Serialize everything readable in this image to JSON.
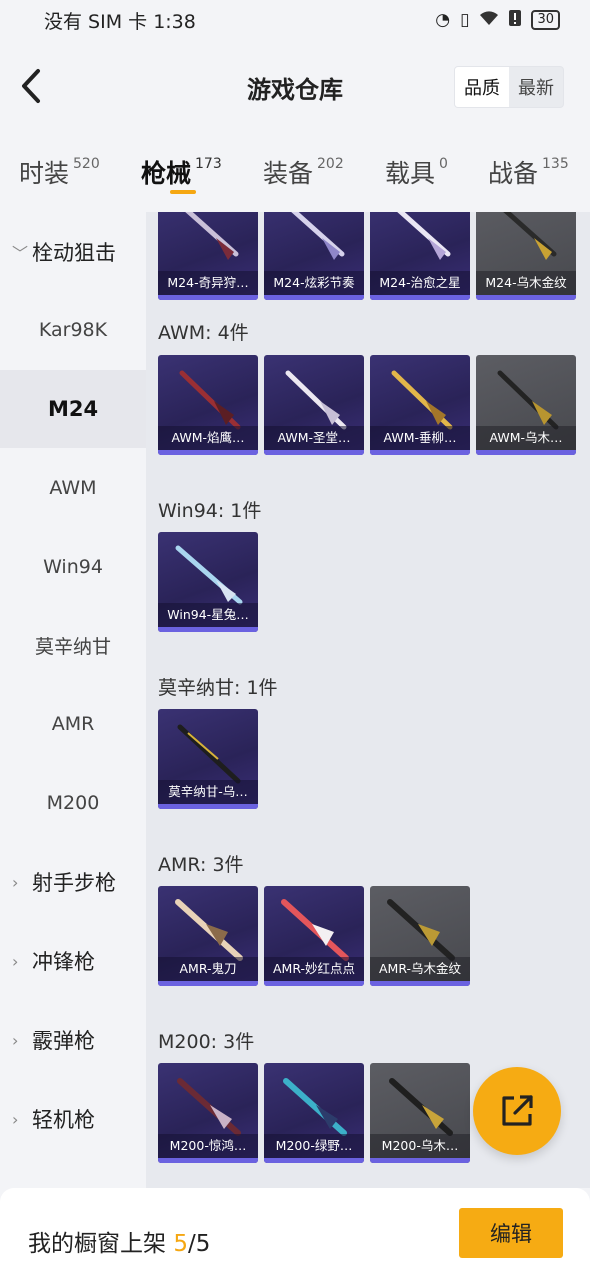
{
  "status": {
    "carrier": "没有 SIM 卡",
    "time": "1:38",
    "battery": "30"
  },
  "header": {
    "title": "游戏仓库",
    "sort_quality": "品质",
    "sort_latest": "最新"
  },
  "tabs": [
    {
      "label": "时装",
      "count": "520"
    },
    {
      "label": "枪械",
      "count": "173"
    },
    {
      "label": "装备",
      "count": "202"
    },
    {
      "label": "载具",
      "count": "0"
    },
    {
      "label": "战备",
      "count": "135"
    }
  ],
  "sidebar": {
    "group_bolt": "栓动狙击",
    "items": [
      "Kar98K",
      "M24",
      "AWM",
      "Win94",
      "莫辛纳甘",
      "AMR",
      "M200"
    ],
    "group_dmr": "射手步枪",
    "group_smg": "冲锋枪",
    "group_shotgun": "霰弹枪",
    "group_lmg": "轻机枪"
  },
  "sections": {
    "m24_cards": [
      "M24-奇异狩…",
      "M24-炫彩节奏",
      "M24-治愈之星",
      "M24-乌木金纹"
    ],
    "awm_title": "AWM: 4件",
    "awm_cards": [
      "AWM-焰鹰…",
      "AWM-圣堂…",
      "AWM-垂柳…",
      "AWM-乌木…"
    ],
    "win94_title": "Win94: 1件",
    "win94_cards": [
      "Win94-星兔…"
    ],
    "mosin_title": "莫辛纳甘: 1件",
    "mosin_cards": [
      "莫辛纳甘-乌…"
    ],
    "amr_title": "AMR: 3件",
    "amr_cards": [
      "AMR-鬼刀",
      "AMR-妙红点点",
      "AMR-乌木金纹"
    ],
    "m200_title": "M200: 3件",
    "m200_cards": [
      "M200-惊鸿…",
      "M200-绿野…",
      "M200-乌木…"
    ]
  },
  "footer": {
    "label": "我的橱窗上架",
    "shown": "5",
    "separator": "/",
    "total": "5",
    "edit_label": "编辑"
  },
  "colors": {
    "accent": "#f6ab13",
    "card_purple": "#2a2358",
    "card_gray": "#4b4c51"
  }
}
